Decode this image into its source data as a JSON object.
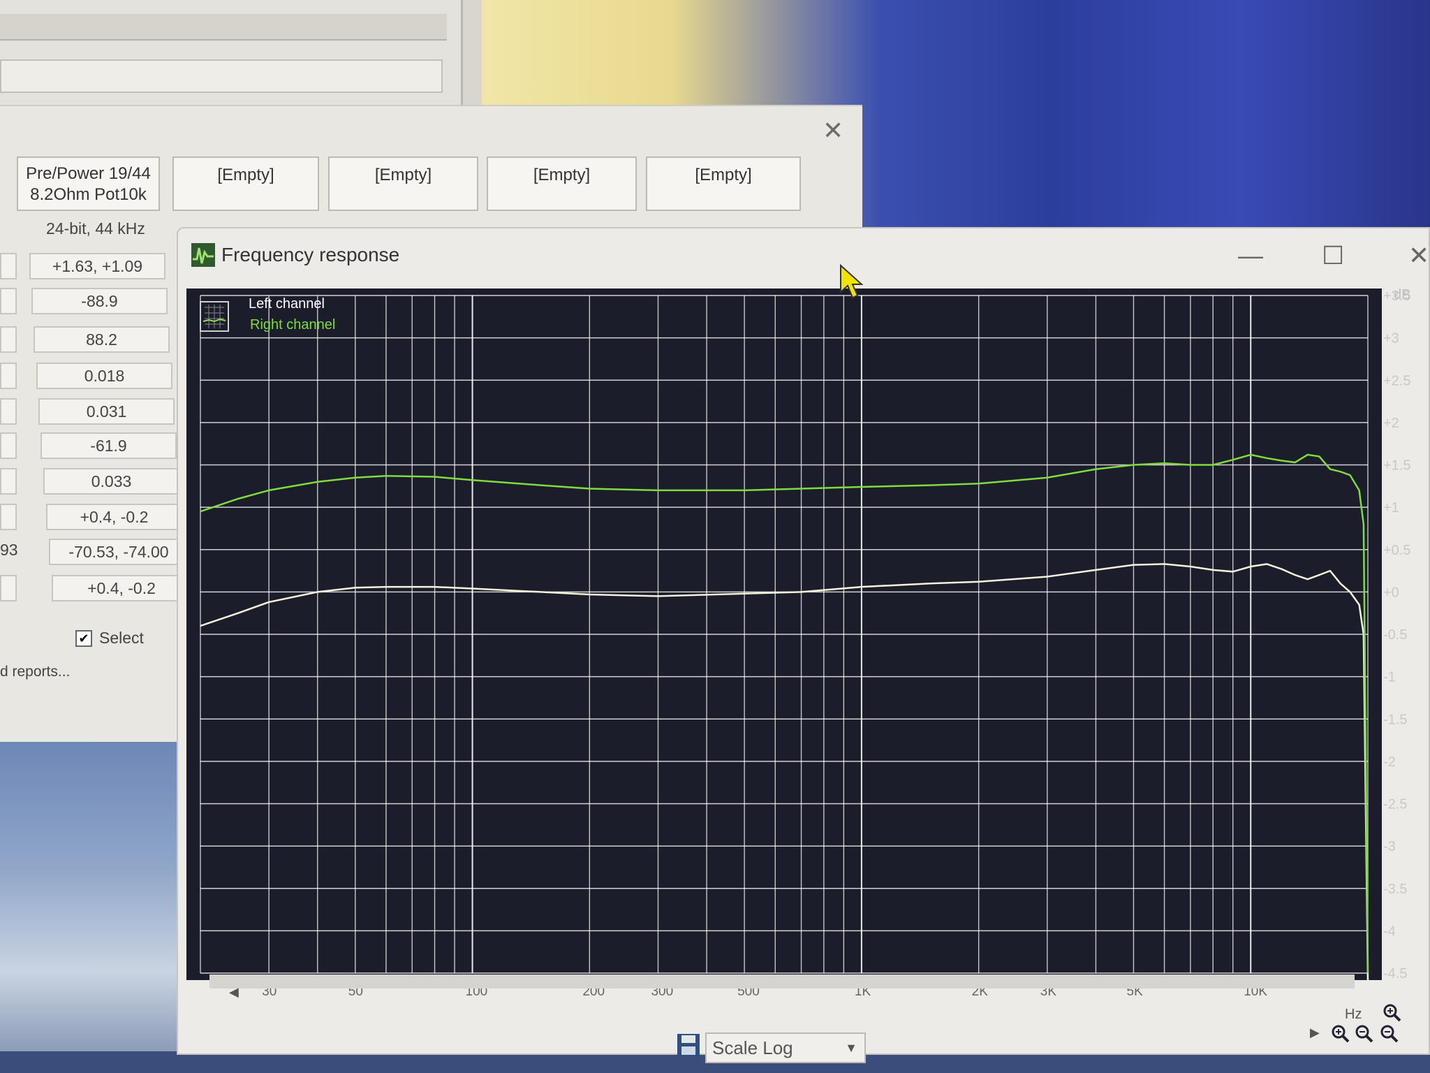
{
  "analyzer": {
    "tabs": [
      {
        "line1": "Pre/Power 19/44",
        "line2": "8.2Ohm Pot10k"
      },
      {
        "line1": "[Empty]"
      },
      {
        "line1": "[Empty]"
      },
      {
        "line1": "[Empty]"
      },
      {
        "line1": "[Empty]"
      }
    ],
    "format": "24-bit, 44 kHz",
    "values": [
      "+1.63, +1.09",
      "-88.9",
      "88.2",
      "0.018",
      "0.031",
      "-61.9",
      "0.033",
      "+0.4, -0.2",
      "-70.53, -74.00",
      "+0.4, -0.2"
    ],
    "left_partial": "93",
    "select_label": "Select",
    "reports_label": "d reports..."
  },
  "freq_window": {
    "title": "Frequency response",
    "minimize": "—",
    "maximize": "☐",
    "close": "✕",
    "scale_label": "Scale Log",
    "colors": {
      "left": "#f4f3d9",
      "right": "#7fdc3c",
      "grid": "#ffffff",
      "background": "#1c1d2b"
    }
  },
  "chart_data": {
    "type": "line",
    "title": "",
    "xlabel": "Hz",
    "ylabel": "dB",
    "x_scale": "log",
    "xlim": [
      20,
      20000
    ],
    "ylim": [
      -4.5,
      3.5
    ],
    "x_ticks": [
      {
        "v": 30,
        "label": "30"
      },
      {
        "v": 50,
        "label": "50"
      },
      {
        "v": 100,
        "label": "100"
      },
      {
        "v": 200,
        "label": "200"
      },
      {
        "v": 300,
        "label": "300"
      },
      {
        "v": 500,
        "label": "500"
      },
      {
        "v": 1000,
        "label": "1K"
      },
      {
        "v": 2000,
        "label": "2K"
      },
      {
        "v": 3000,
        "label": "3K"
      },
      {
        "v": 5000,
        "label": "5K"
      },
      {
        "v": 10000,
        "label": "10K"
      }
    ],
    "y_ticks": [
      {
        "v": 3.5,
        "label": "+3.5"
      },
      {
        "v": 3,
        "label": "+3"
      },
      {
        "v": 2.5,
        "label": "+2.5"
      },
      {
        "v": 2,
        "label": "+2"
      },
      {
        "v": 1.5,
        "label": "+1.5"
      },
      {
        "v": 1,
        "label": "+1"
      },
      {
        "v": 0.5,
        "label": "+0.5"
      },
      {
        "v": 0,
        "label": "+0"
      },
      {
        "v": -0.5,
        "label": "-0.5"
      },
      {
        "v": -1,
        "label": "-1"
      },
      {
        "v": -1.5,
        "label": "-1.5"
      },
      {
        "v": -2,
        "label": "-2"
      },
      {
        "v": -2.5,
        "label": "-2.5"
      },
      {
        "v": -3,
        "label": "-3"
      },
      {
        "v": -3.5,
        "label": "-3.5"
      },
      {
        "v": -4,
        "label": "-4"
      },
      {
        "v": -4.5,
        "label": "-4.5"
      }
    ],
    "grid": true,
    "legend_position": "top-left",
    "series": [
      {
        "name": "Left channel",
        "color": "#f4f3d9",
        "x": [
          20,
          25,
          30,
          40,
          50,
          60,
          80,
          100,
          150,
          200,
          300,
          500,
          700,
          1000,
          1500,
          2000,
          3000,
          4000,
          5000,
          6000,
          7000,
          8000,
          9000,
          10000,
          11000,
          12000,
          13000,
          14000,
          15000,
          16000,
          17000,
          18000,
          19000,
          19500,
          20000
        ],
        "y": [
          -0.4,
          -0.25,
          -0.12,
          0.0,
          0.05,
          0.06,
          0.06,
          0.04,
          0.0,
          -0.03,
          -0.05,
          -0.02,
          0.0,
          0.06,
          0.1,
          0.12,
          0.18,
          0.26,
          0.32,
          0.33,
          0.3,
          0.26,
          0.24,
          0.3,
          0.33,
          0.27,
          0.2,
          0.15,
          0.2,
          0.25,
          0.1,
          0.0,
          -0.15,
          -0.5,
          -4.6
        ]
      },
      {
        "name": "Right channel",
        "color": "#7fdc3c",
        "x": [
          20,
          25,
          30,
          40,
          50,
          60,
          80,
          100,
          150,
          200,
          300,
          500,
          700,
          1000,
          1500,
          2000,
          3000,
          4000,
          5000,
          6000,
          7000,
          8000,
          9000,
          10000,
          11000,
          12000,
          13000,
          14000,
          15000,
          16000,
          17000,
          18000,
          19000,
          19500,
          20000
        ],
        "y": [
          0.95,
          1.1,
          1.2,
          1.3,
          1.35,
          1.37,
          1.36,
          1.32,
          1.26,
          1.22,
          1.2,
          1.2,
          1.22,
          1.24,
          1.26,
          1.28,
          1.35,
          1.45,
          1.5,
          1.52,
          1.5,
          1.5,
          1.56,
          1.62,
          1.58,
          1.55,
          1.53,
          1.62,
          1.6,
          1.45,
          1.42,
          1.38,
          1.2,
          0.8,
          -4.5
        ]
      }
    ]
  }
}
